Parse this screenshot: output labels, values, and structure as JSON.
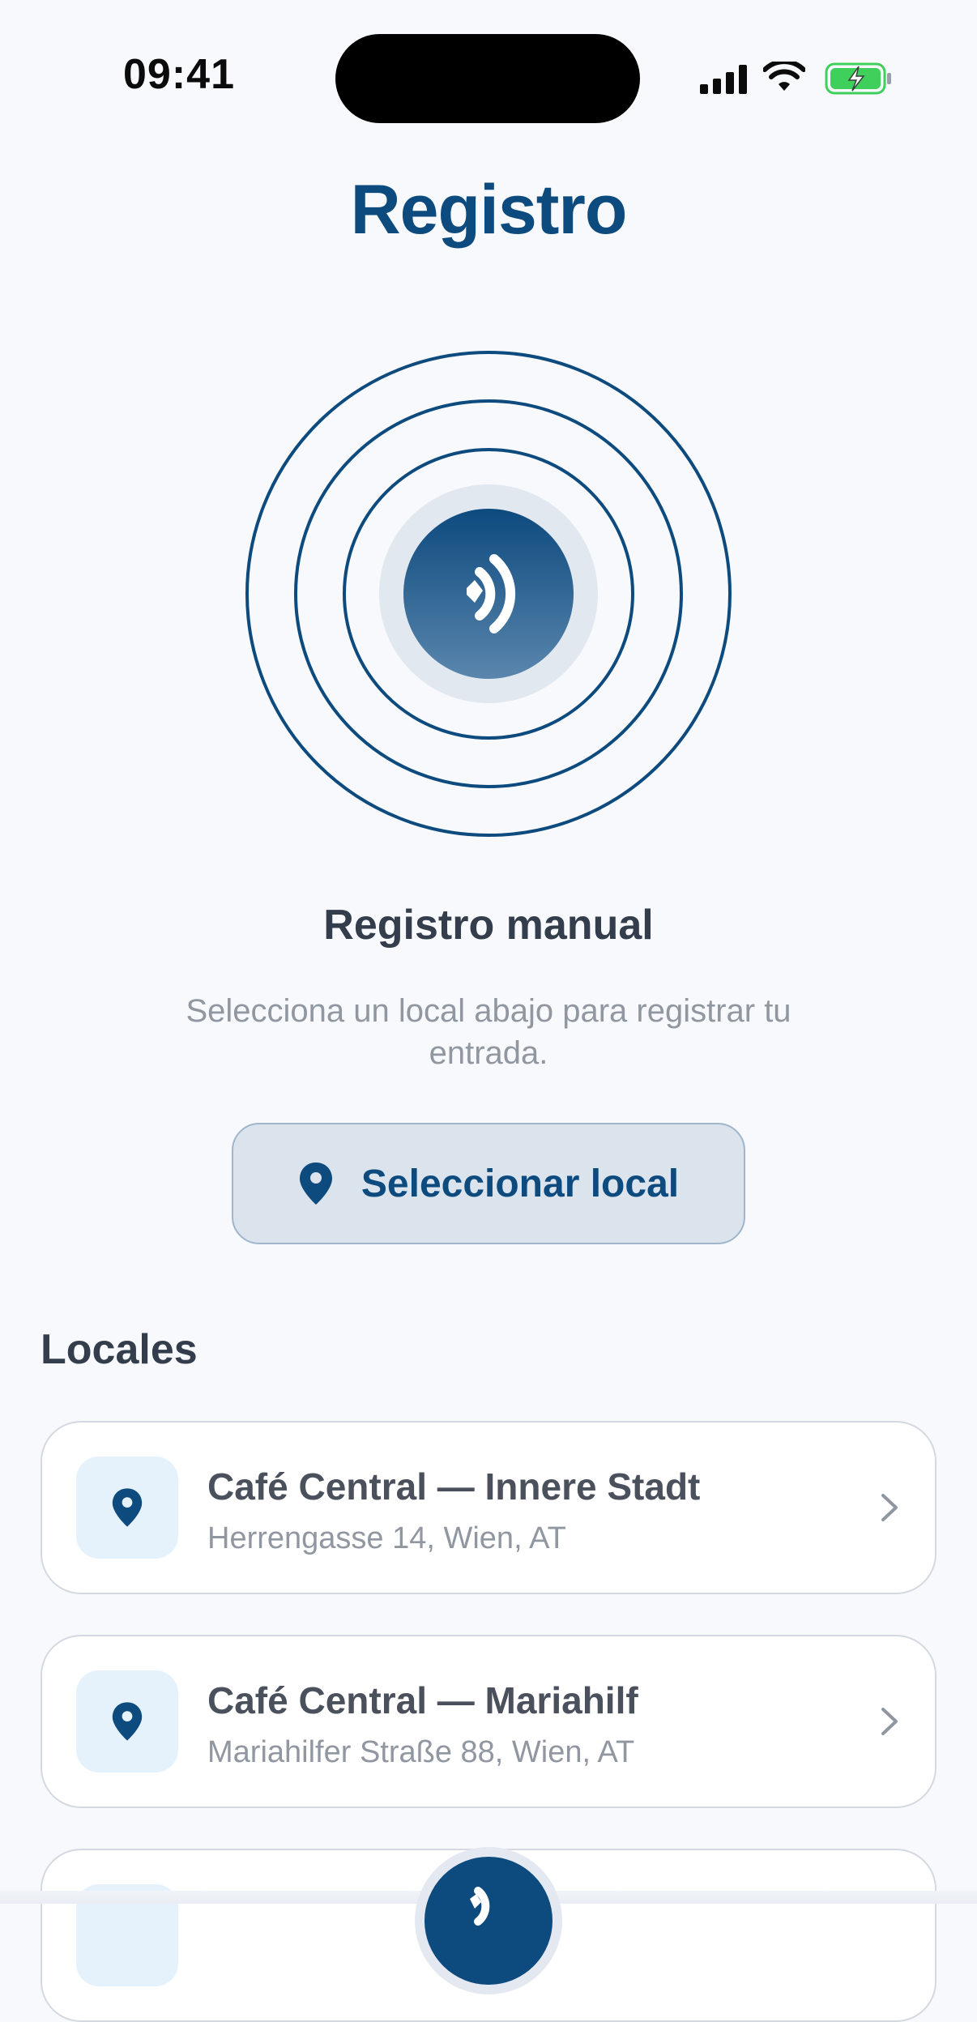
{
  "status_bar": {
    "time": "09:41"
  },
  "header": {
    "title": "Registro"
  },
  "manual_section": {
    "heading": "Registro manual",
    "description": "Selecciona un local abajo para registrar tu entrada.",
    "select_button_label": "Seleccionar local"
  },
  "locales": {
    "heading": "Locales",
    "items": [
      {
        "name": "Café Central — Innere Stadt",
        "address": "Herrengasse 14, Wien, AT"
      },
      {
        "name": "Café Central — Mariahilf",
        "address": "Mariahilfer Straße 88, Wien, AT"
      }
    ]
  },
  "icons": {
    "nfc": "nfc-icon",
    "pin": "location-pin-icon",
    "chevron": "chevron-right-icon"
  },
  "colors": {
    "brand": "#0d4a7e",
    "background": "#f7f9fc",
    "heading_text": "#343d4c",
    "muted_text": "#9197a1",
    "battery_green": "#3fd05b"
  }
}
